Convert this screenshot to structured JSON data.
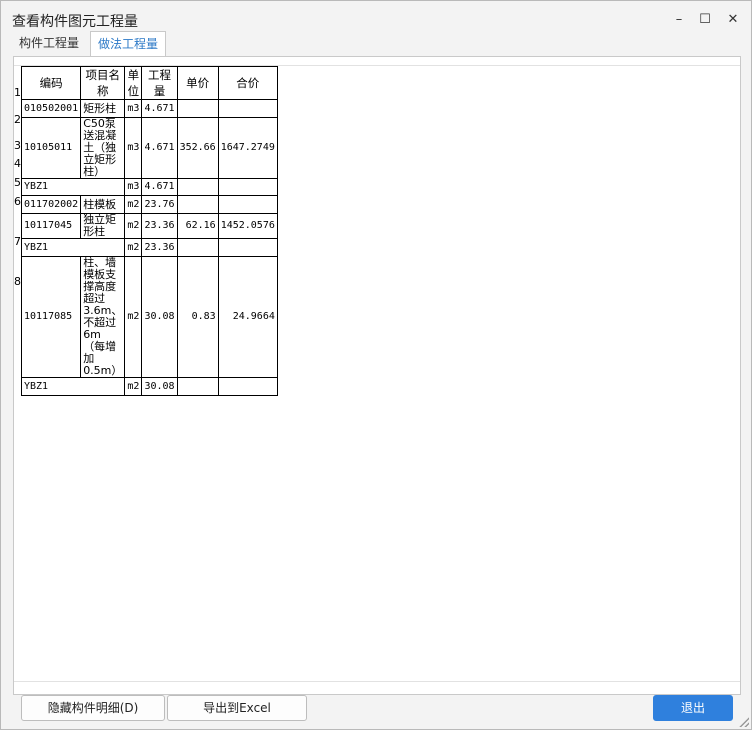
{
  "window": {
    "title": "查看构件图元工程量"
  },
  "window_controls": {
    "minimize": "–",
    "maximize": "☐",
    "close": "✕"
  },
  "tabs": [
    {
      "label": "构件工程量",
      "active": false
    },
    {
      "label": "做法工程量",
      "active": true
    }
  ],
  "table": {
    "headers": [
      "编码",
      "项目名称",
      "单位",
      "工程量",
      "单价",
      "合价"
    ],
    "rows": [
      {
        "num": "1",
        "code": "010502001",
        "name": "矩形柱",
        "unit": "m3",
        "qty": "4.671",
        "price": "",
        "total": ""
      },
      {
        "num": "2",
        "code": "10105011",
        "name": "C50泵送混凝土（独立矩形柱）",
        "unit": "m3",
        "qty": "4.671",
        "price": "352.66",
        "total": "1647.2749"
      },
      {
        "num": "3",
        "code": "YBZ1",
        "name": "",
        "unit": "m3",
        "qty": "4.671",
        "price": "",
        "total": ""
      },
      {
        "num": "4",
        "code": "011702002",
        "name": "柱模板",
        "unit": "m2",
        "qty": "23.76",
        "price": "",
        "total": ""
      },
      {
        "num": "5",
        "code": "10117045",
        "name": "独立矩形柱",
        "unit": "m2",
        "qty": "23.36",
        "price": "62.16",
        "total": "1452.0576"
      },
      {
        "num": "6",
        "code": "YBZ1",
        "name": "",
        "unit": "m2",
        "qty": "23.36",
        "price": "",
        "total": ""
      },
      {
        "num": "7",
        "code": "10117085",
        "name": "柱、墙模板支撑高度超过3.6m、不超过6m（每增加0.5m）",
        "unit": "m2",
        "qty": "30.08",
        "price": "0.83",
        "total": "24.9664"
      },
      {
        "num": "8",
        "code": "YBZ1",
        "name": "",
        "unit": "m2",
        "qty": "30.08",
        "price": "",
        "total": ""
      }
    ]
  },
  "buttons": {
    "hide_detail": "隐藏构件明细(D)",
    "export_excel": "导出到Excel",
    "exit": "退出"
  },
  "colors": {
    "accent": "#2f80dd",
    "active_tab_text": "#2c79c7"
  }
}
